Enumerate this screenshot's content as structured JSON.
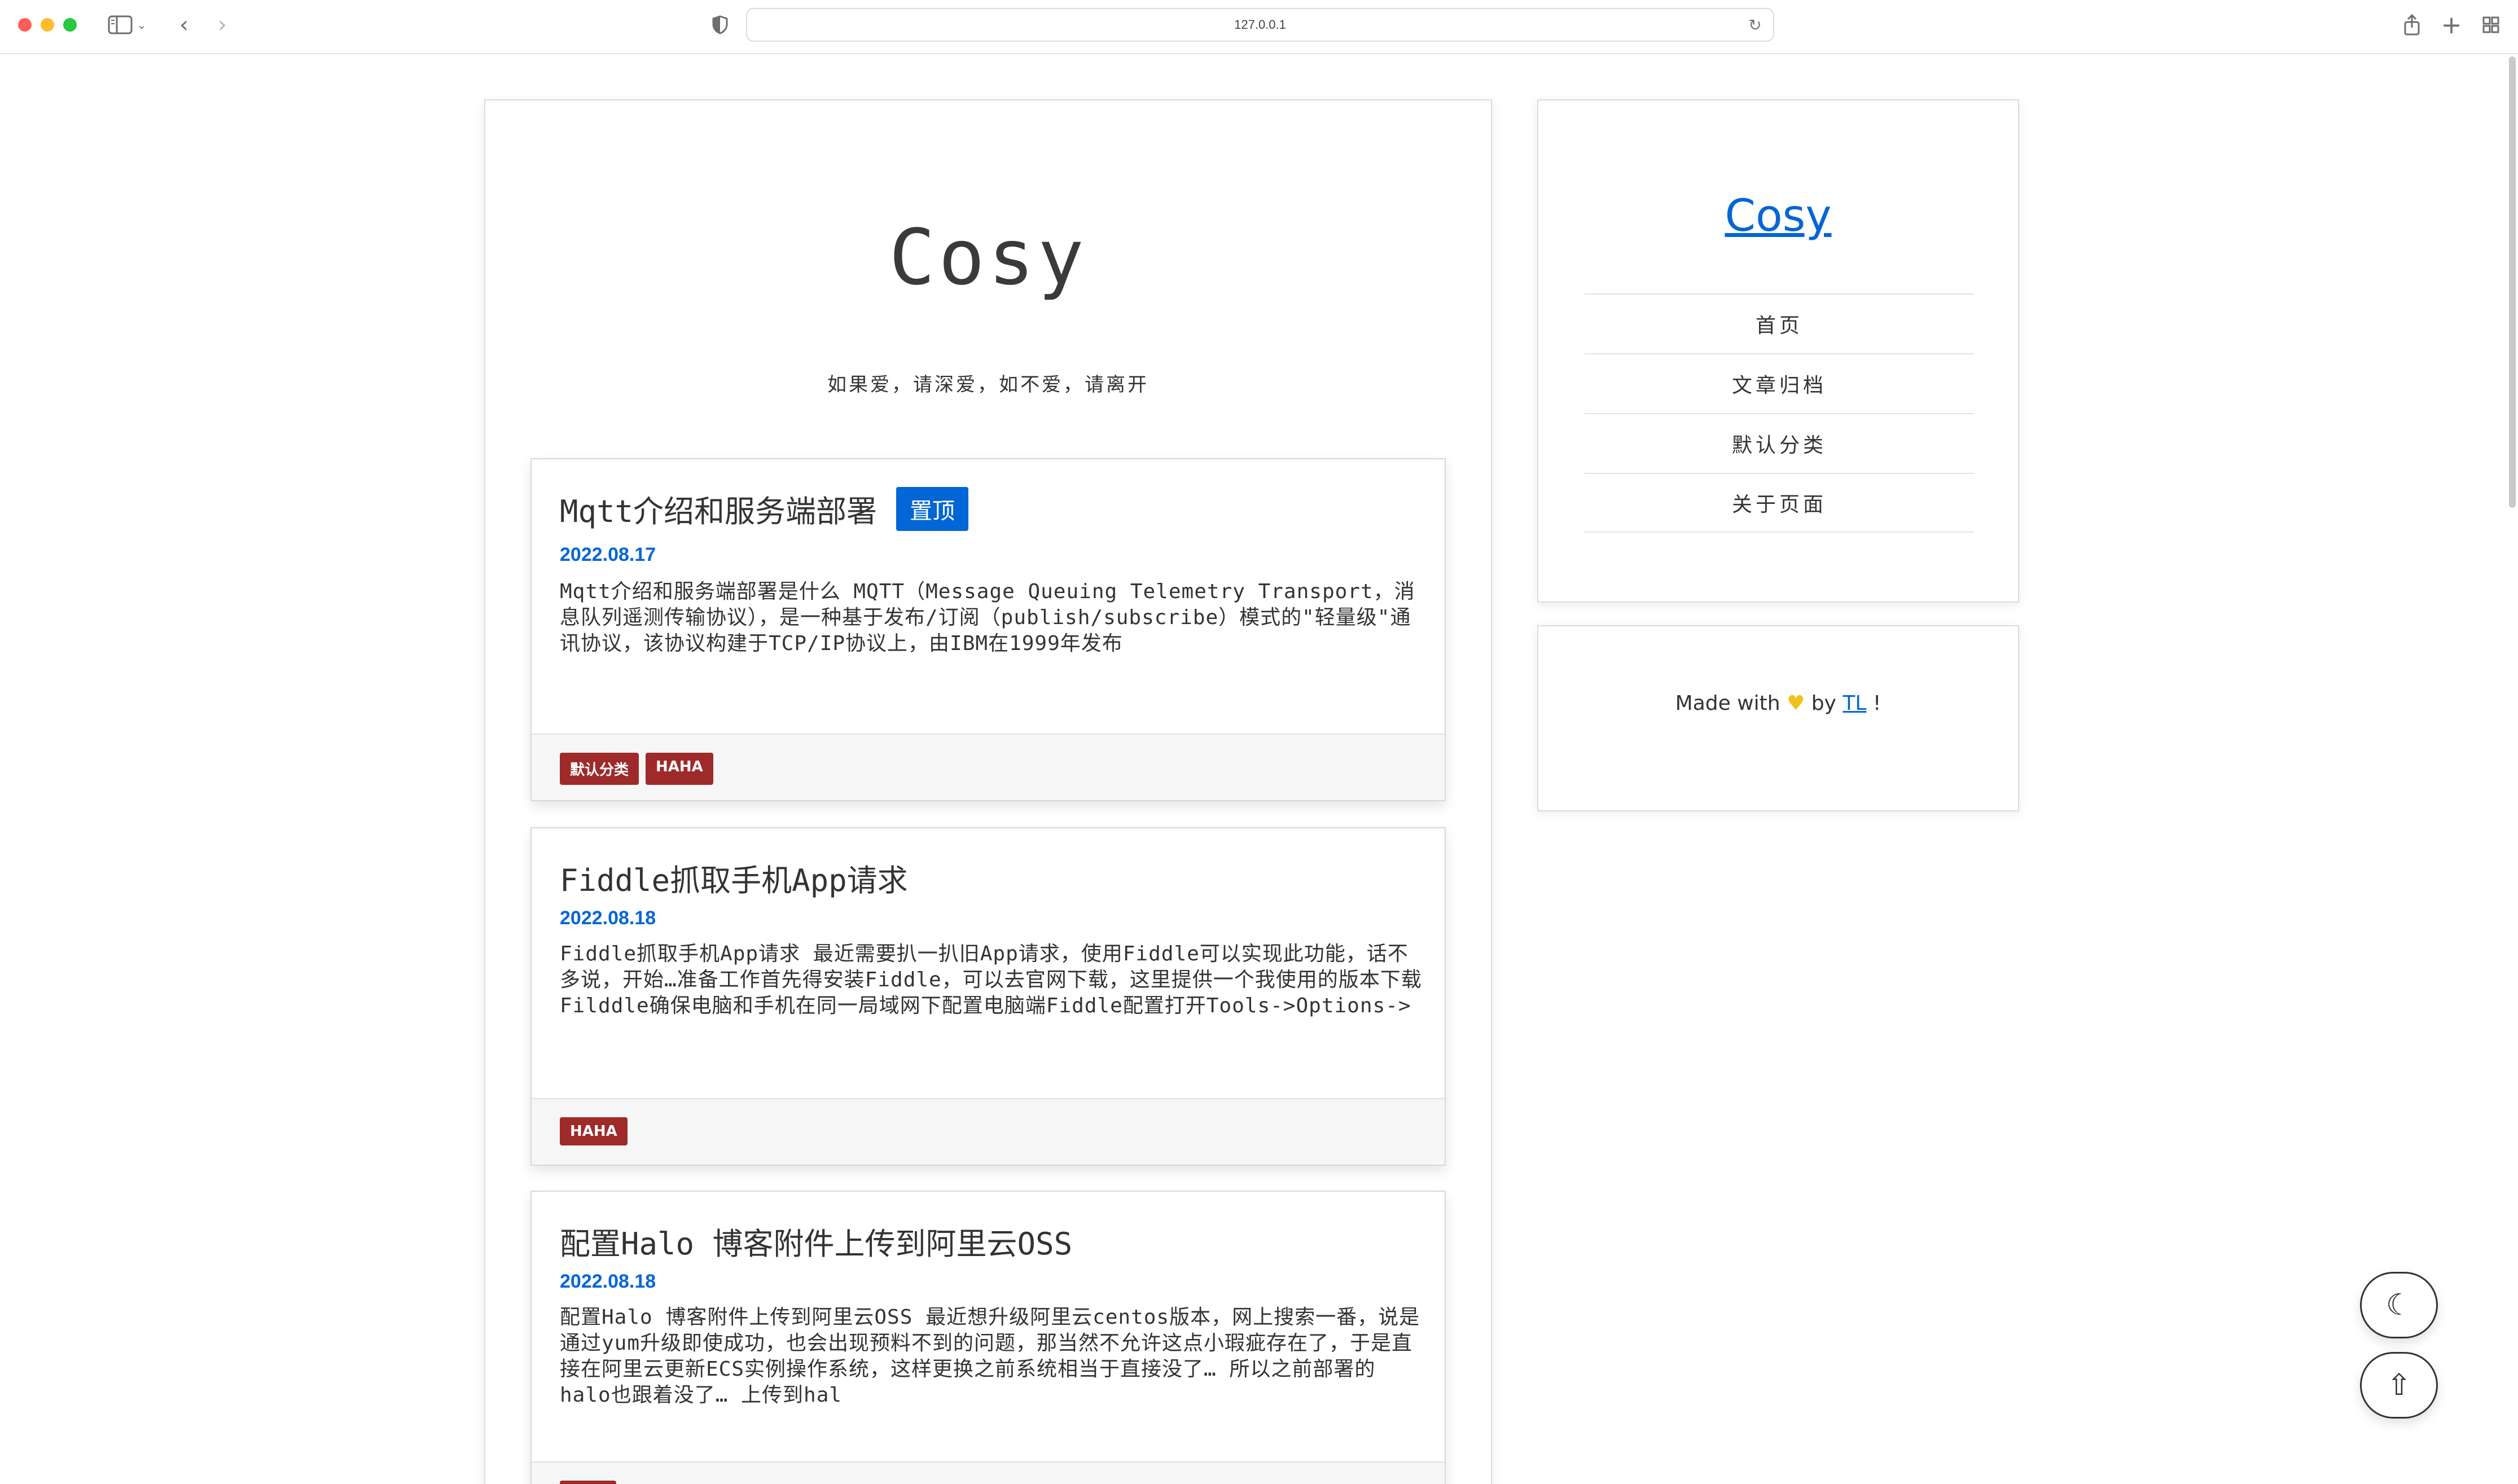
{
  "browser": {
    "url": "127.0.0.1"
  },
  "site": {
    "title": "Cosy",
    "subtitle": "如果爱，请深爱，如不爱，请离开"
  },
  "posts": [
    {
      "title": "Mqtt介绍和服务端部署",
      "pinned_label": "置顶",
      "date": "2022.08.17",
      "excerpt": "Mqtt介绍和服务端部署是什么 MQTT（Message Queuing Telemetry Transport，消息队列遥测传输协议），是一种基于发布/订阅（publish/subscribe）模式的\"轻量级\"通讯协议，该协议构建于TCP/IP协议上，由IBM在1999年发布",
      "tags": [
        "默认分类",
        "HAHA"
      ]
    },
    {
      "title": "Fiddle抓取手机App请求",
      "date": "2022.08.18",
      "excerpt": "Fiddle抓取手机App请求 最近需要扒一扒旧App请求，使用Fiddle可以实现此功能，话不多说，开始…准备工作首先得安装Fiddle，可以去官网下载，这里提供一个我使用的版本下载Filddle确保电脑和手机在同一局域网下配置电脑端Fiddle配置打开Tools->Options->",
      "tags": [
        "HAHA"
      ]
    },
    {
      "title": "配置Halo 博客附件上传到阿里云OSS",
      "date": "2022.08.18",
      "excerpt": "配置Halo 博客附件上传到阿里云OSS 最近想升级阿里云centos版本，网上搜索一番，说是通过yum升级即使成功，也会出现预料不到的问题，那当然不允许这点小瑕疵存在了，于是直接在阿里云更新ECS实例操作系统，这样更换之前系统相当于直接没了… 所以之前部署的halo也跟着没了… 上传到hal",
      "tags": [
        ""
      ]
    }
  ],
  "sidebar": {
    "title": "Cosy",
    "nav": [
      "首页",
      "文章归档",
      "默认分类",
      "关于页面"
    ],
    "footer": {
      "prefix": "Made with",
      "by": "by",
      "author": "TL",
      "suffix": "!"
    }
  },
  "colors": {
    "accent": "#0366d6",
    "tag": "#9e2a2a",
    "heart": "#f2c11c"
  }
}
